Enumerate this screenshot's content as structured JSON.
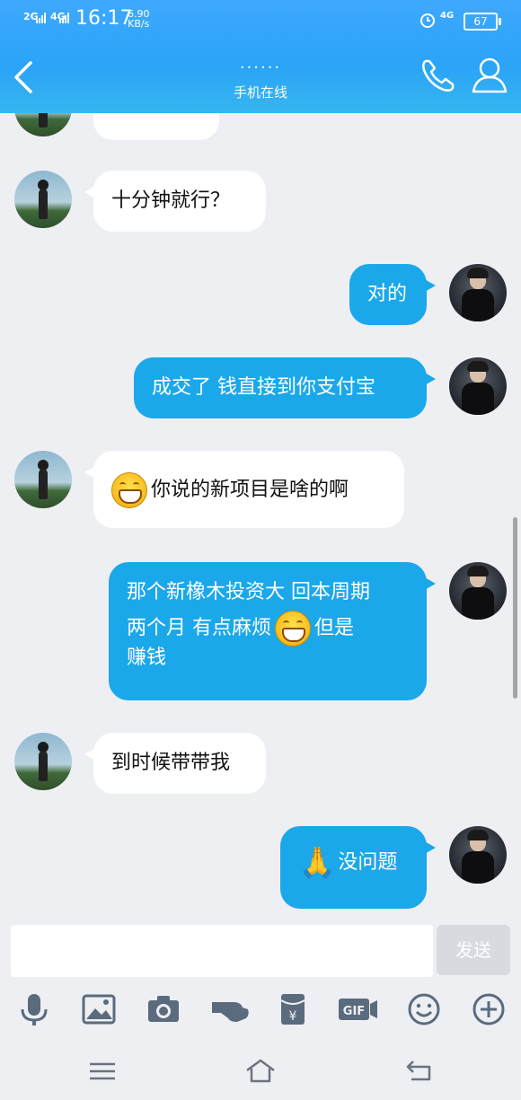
{
  "status_bar": {
    "network1": "2G",
    "network2": "4G",
    "time": "16:17",
    "speed_value": "6.90",
    "speed_unit": "KB/s",
    "net_right": "4G",
    "battery": "67"
  },
  "header": {
    "title_dots": "......",
    "subtitle": "手机在线"
  },
  "messages": [
    {
      "side": "in",
      "text": "十分钟就行？"
    },
    {
      "side": "out",
      "text": "对的"
    },
    {
      "side": "out",
      "text": "成交了 钱直接到你支付宝"
    },
    {
      "side": "in",
      "text": "你说的新项目是啥的啊",
      "emoji": "grin-emoji"
    },
    {
      "side": "out",
      "line1": "那个新橡木投资大 回本周期",
      "line2a": "两个月  有点麻烦",
      "line2b": "但是",
      "line3": "赚钱",
      "emoji": "grin-emoji"
    },
    {
      "side": "in",
      "text": "到时候带带我"
    },
    {
      "side": "out",
      "text": "没问题",
      "emoji": "pray-emoji"
    }
  ],
  "input": {
    "placeholder": "",
    "send_label": "发送"
  },
  "colors": {
    "header": "#2aa4f6",
    "bubble_out": "#1ba8ea",
    "bubble_in": "#ffffff",
    "background": "#eeeff3"
  },
  "toolbar_icons": [
    "microphone-icon",
    "image-icon",
    "camera-icon",
    "hand-icon",
    "red-packet-icon",
    "gif-icon",
    "smiley-icon",
    "plus-icon"
  ],
  "nav_icons": [
    "menu-icon",
    "home-icon",
    "back-icon"
  ]
}
